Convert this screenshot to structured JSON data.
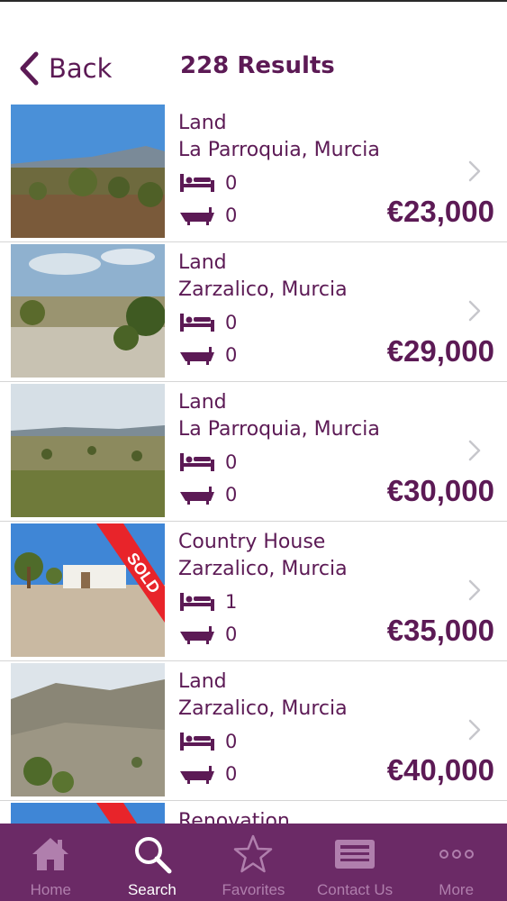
{
  "nav": {
    "back_label": "Back",
    "title": "228 Results"
  },
  "listings": [
    {
      "type": "Land",
      "location": "La Parroquia, Murcia",
      "beds": "0",
      "baths": "0",
      "price": "€23,000",
      "sold": false
    },
    {
      "type": "Land",
      "location": "Zarzalico, Murcia",
      "beds": "0",
      "baths": "0",
      "price": "€29,000",
      "sold": false
    },
    {
      "type": "Land",
      "location": "La Parroquia, Murcia",
      "beds": "0",
      "baths": "0",
      "price": "€30,000",
      "sold": false
    },
    {
      "type": "Country House",
      "location": "Zarzalico, Murcia",
      "beds": "1",
      "baths": "0",
      "price": "€35,000",
      "sold": true,
      "sold_label": "SOLD"
    },
    {
      "type": "Land",
      "location": "Zarzalico, Murcia",
      "beds": "0",
      "baths": "0",
      "price": "€40,000",
      "sold": false
    },
    {
      "type": "Renovation",
      "location": "",
      "beds": "",
      "baths": "",
      "price": "",
      "sold": true
    }
  ],
  "tabs": [
    {
      "label": "Home",
      "icon": "home-icon",
      "active": false
    },
    {
      "label": "Search",
      "icon": "search-icon",
      "active": true
    },
    {
      "label": "Favorites",
      "icon": "star-icon",
      "active": false
    },
    {
      "label": "Contact Us",
      "icon": "contact-card-icon",
      "active": false
    },
    {
      "label": "More",
      "icon": "more-dots-icon",
      "active": false
    }
  ],
  "colors": {
    "brand_purple": "#5c1a55",
    "tab_bar": "#6b2a66",
    "tab_inactive": "#b07fad",
    "tab_active": "#ffffff",
    "sold_ribbon": "#e8242a"
  }
}
